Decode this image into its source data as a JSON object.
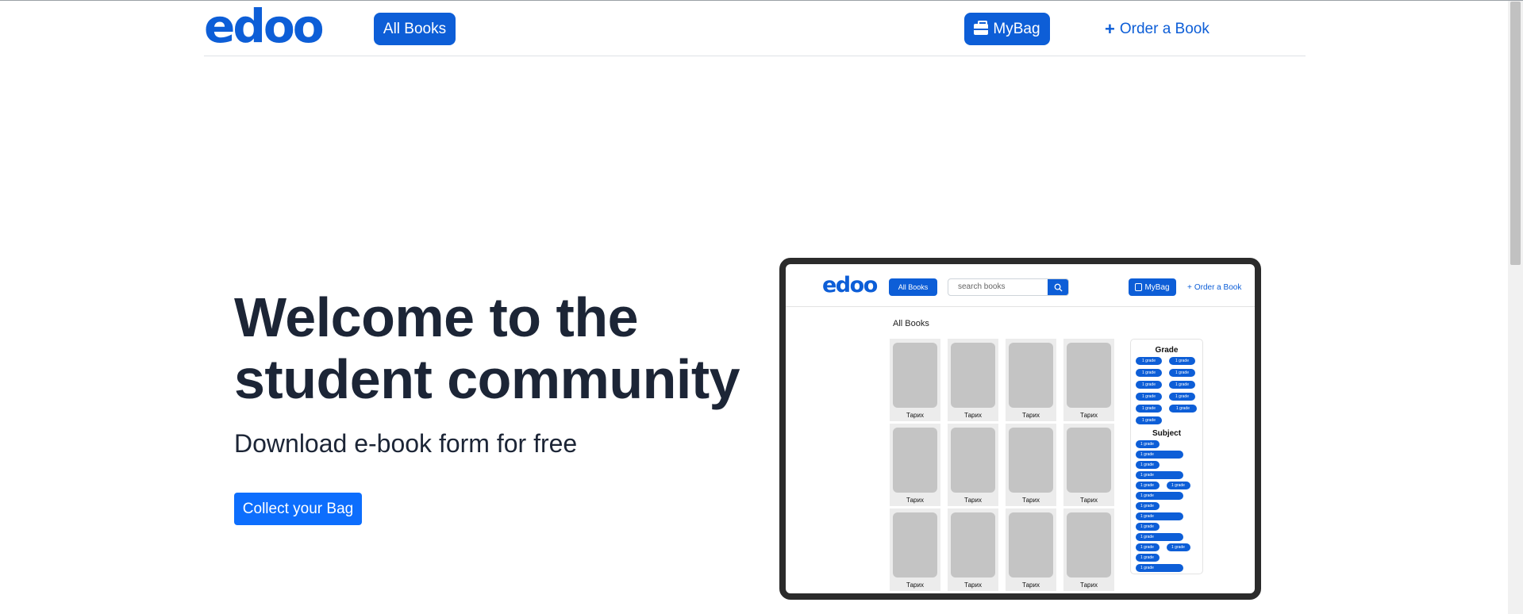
{
  "header": {
    "logo": "edoo",
    "all_books_label": "All Books",
    "mybag_label": "MyBag",
    "order_label": "Order a Book"
  },
  "hero": {
    "title_line1": "Welcome to the",
    "title_line2": "student community",
    "subtitle": "Download e-book form for free",
    "cta_label": "Collect your Bag"
  },
  "mockup": {
    "logo": "edoo",
    "all_books_label": "All Books",
    "search_placeholder": "search books",
    "mybag_label": "MyBag",
    "order_label": "Order a Book",
    "section_title": "All Books",
    "books": [
      "Тарих",
      "Тарих",
      "Тарих",
      "Тарих",
      "Тарих",
      "Тарих",
      "Тарих",
      "Тарих",
      "Тарих",
      "Тарих",
      "Тарих",
      "Тарих"
    ],
    "filter": {
      "grade_title": "Grade",
      "grade_pills": [
        "1 grade",
        "1 grade",
        "1 grade",
        "1 grade",
        "1 grade",
        "1 grade",
        "1 grade",
        "1 grade",
        "1 grade",
        "1 grade",
        "1 grade"
      ],
      "subject_title": "Subject",
      "subject_pills": [
        "1 grade",
        "1 grade",
        "1 grade",
        "1 grade",
        "1 grade",
        "1 grade",
        "1 grade",
        "1 grade",
        "1 grade",
        "1 grade",
        "1 grade",
        "1 grade",
        "1 grade",
        "1 grade",
        "1 grade"
      ]
    }
  },
  "colors": {
    "brand": "#0d5ed7",
    "cta": "#0d6efd",
    "text": "#1c2536"
  }
}
